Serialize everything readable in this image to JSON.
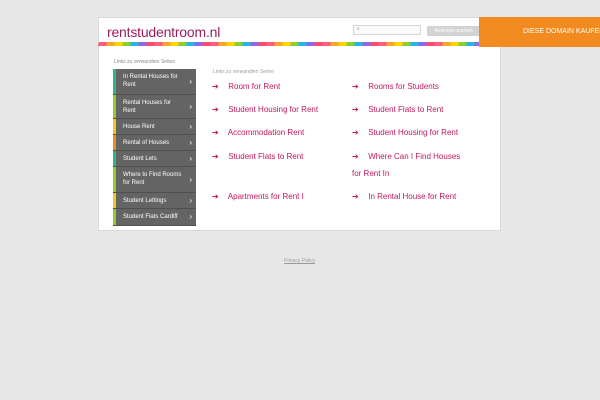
{
  "header": {
    "site_name": "rentstudentroom.nl",
    "search": {
      "placeholder": "",
      "button_label": "Anzeigen suchen"
    },
    "banner_label": "DIESE DOMAIN KAUFEN"
  },
  "sidebar": {
    "label": "Links zu verwandten Seiten",
    "items": [
      {
        "label": "In Rental Houses for Rent",
        "accent": "#2db88b"
      },
      {
        "label": "Rental Houses for Rent",
        "accent": "#9ac62f"
      },
      {
        "label": "House Rent",
        "accent": "#f3c519"
      },
      {
        "label": "Rental of Houses",
        "accent": "#f28b1f"
      },
      {
        "label": "Student Lets",
        "accent": "#2db88b"
      },
      {
        "label": "Where to Find Rooms for Rent",
        "accent": "#9ac62f"
      },
      {
        "label": "Student Lettings",
        "accent": "#f3c519"
      },
      {
        "label": "Student Flats Cardiff",
        "accent": "#9ac62f"
      }
    ]
  },
  "main": {
    "links_label": "Links zu verwandten Seiten",
    "links": [
      {
        "text": "Room for Rent"
      },
      {
        "text": "Rooms for Students"
      },
      {
        "text": "Student Housing for Rent"
      },
      {
        "text": "Student Flats to Rent"
      },
      {
        "text": "Accommodation Rent"
      },
      {
        "text": "Student Housing for Rent"
      },
      {
        "text": "Student Flats to Rent"
      },
      {
        "text": "Where Can I Find Houses for Rent In"
      },
      {
        "text": "Apartments for Rent I"
      },
      {
        "text": "In Rental House for Rent"
      }
    ]
  },
  "footer": {
    "privacy_label": "Privacy Policy"
  }
}
